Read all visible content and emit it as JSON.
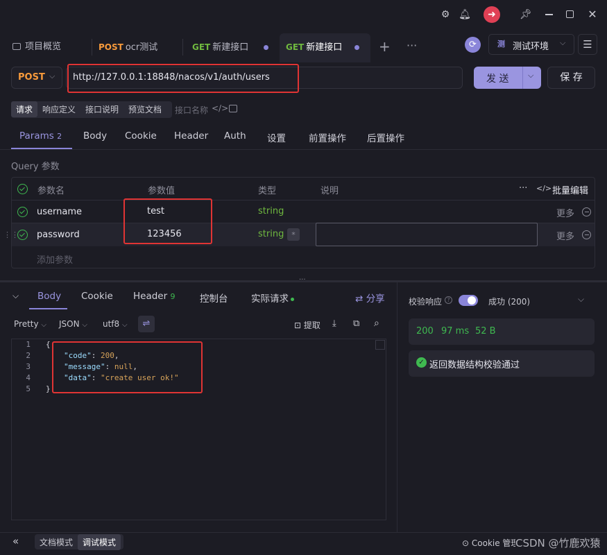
{
  "tabs": [
    {
      "method": "",
      "label": "项目概览"
    },
    {
      "method": "POST",
      "label": "ocr测试"
    },
    {
      "method": "GET",
      "label": "新建接口"
    },
    {
      "method": "GET",
      "label": "新建接口"
    }
  ],
  "env": {
    "badge": "测",
    "label": "测试环境"
  },
  "request": {
    "method": "POST",
    "url": "http://127.0.0.1:18848/nacos/v1/auth/users",
    "send": "发 送",
    "save": "保 存"
  },
  "subtabs": [
    "请求",
    "响应定义",
    "接口说明",
    "预览文档"
  ],
  "name_placeholder": "接口名称",
  "paramtabs": {
    "params": "Params",
    "params_count": "2",
    "body": "Body",
    "cookie": "Cookie",
    "header": "Header",
    "auth": "Auth",
    "settings": "设置",
    "pre": "前置操作",
    "post": "后置操作"
  },
  "query_title": "Query 参数",
  "table": {
    "headers": {
      "name": "参数名",
      "value": "参数值",
      "type": "类型",
      "desc": "说明"
    },
    "bulk_edit": "批量编辑",
    "rows": [
      {
        "name": "username",
        "value": "test",
        "type": "string",
        "more": "更多"
      },
      {
        "name": "password",
        "value": "123456",
        "type": "string",
        "more": "更多",
        "required": "*"
      }
    ],
    "add": "添加参数"
  },
  "response": {
    "tabs": {
      "body": "Body",
      "cookie": "Cookie",
      "header": "Header",
      "header_count": "9",
      "console": "控制台",
      "actual": "实际请求"
    },
    "share": "分享",
    "format": {
      "pretty": "Pretty",
      "json": "JSON",
      "enc": "utf8"
    },
    "extract": "提取",
    "lines": [
      "1",
      "2",
      "3",
      "4",
      "5"
    ],
    "code": {
      "open": "{",
      "k1": "\"code\"",
      "v1": "200",
      "k2": "\"message\"",
      "v2": "null",
      "k3": "\"data\"",
      "v3": "\"create user ok!\"",
      "close": "}"
    }
  },
  "validate": {
    "label": "校验响应",
    "result": "成功 (200)",
    "status": "200",
    "time": "97 ms",
    "size": "52 B",
    "message": "返回数据结构校验通过"
  },
  "footer": {
    "doc_mode": "文档模式",
    "debug_mode": "调试模式",
    "cookie": "Cookie 管理",
    "watermark": "CSDN @竹鹿欢猿"
  },
  "colors": {
    "accent": "#8a85d9",
    "post": "#f79a3b",
    "get": "#6fb83f",
    "success": "#3fb950",
    "red": "#e03434"
  }
}
